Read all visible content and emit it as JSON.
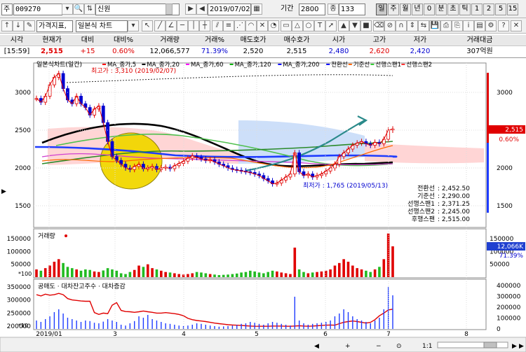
{
  "toolbar": {
    "market_label": "주",
    "code": "009270",
    "name": "신원",
    "date": "2019/07/02",
    "period_label": "기간",
    "period": "2800",
    "count_label": "종",
    "count": "133",
    "intervals": [
      "일",
      "주",
      "월",
      "년",
      "0",
      "분",
      "초",
      "틱",
      "1",
      "2",
      "5",
      "15"
    ],
    "selected_interval": "일",
    "indicator_menu": "가격지표,",
    "chart_type": "일본식 차트"
  },
  "quote": {
    "headers": [
      "시각",
      "현재가",
      "대비",
      "대비%",
      "거래량",
      "거래%",
      "매도호가",
      "매수호가",
      "시가",
      "고가",
      "저가",
      "거래대금"
    ],
    "values": [
      "[15:59]",
      "2,515",
      "+15",
      "0.60%",
      "12,066,577",
      "71.39%",
      "2,520",
      "2,515",
      "2,480",
      "2,620",
      "2,420",
      "307억원"
    ]
  },
  "chart_data": {
    "type": "line",
    "panels": [
      "price",
      "volume",
      "credit"
    ],
    "price_title": "일본식차트(일간)",
    "legend": [
      "MA_종가,5",
      "MA_종가,20",
      "MA_종가,60",
      "MA_종가,120",
      "MA_종가,200",
      "전환선",
      "기준선",
      "선행스팬1",
      "선행스팬2"
    ],
    "legend_colors": [
      "#ff0000",
      "#000000",
      "#ff00ff",
      "#00b000",
      "#0000ff",
      "#0000ff",
      "#ff6600",
      "#33cc33",
      "#ff3333"
    ],
    "price_axis": [
      3000,
      2500,
      2000,
      1500
    ],
    "x_ticks": [
      "2019/01",
      "3",
      "4",
      "5",
      "6",
      "7",
      "8"
    ],
    "max_label": "최고가 : 3,310 (2019/02/07)",
    "min_label": "최저가 : 1,765 (2019/05/13)",
    "current_price": "2,515",
    "current_pct": "0.60%",
    "ichimoku": [
      {
        "label": "전환선",
        "value": ": 2,452.50"
      },
      {
        "label": "기준선",
        "value": ": 2,290.00"
      },
      {
        "label": "선행스팬1",
        "value": ": 2,371.25"
      },
      {
        "label": "선행스팬2",
        "value": ": 2,245.00"
      },
      {
        "label": "후행스팬",
        "value": ": 2,515.00"
      }
    ],
    "closes": [
      2920,
      2870,
      2950,
      3100,
      3200,
      3250,
      3050,
      2900,
      2850,
      2950,
      2850,
      2800,
      2700,
      2780,
      2820,
      2600,
      2350,
      2150,
      2100,
      2050,
      2000,
      1980,
      2020,
      2050,
      1990,
      2000,
      2020,
      1980,
      2000,
      2010,
      1990,
      2030,
      2060,
      2090,
      2130,
      2160,
      2140,
      2120,
      2100,
      2110,
      2080,
      2050,
      2030,
      2000,
      1980,
      1970,
      1960,
      1950,
      1940,
      1920,
      1900,
      1860,
      1830,
      1790,
      1800,
      1840,
      1880,
      1920,
      2200,
      1950,
      1900,
      1920,
      1880,
      1900,
      1920,
      1960,
      2000,
      2050,
      2150,
      2200,
      2250,
      2300,
      2330,
      2350,
      2320,
      2300,
      2340,
      2320,
      2380,
      2500,
      2515
    ],
    "volume_label": "거래량",
    "volume_axis": [
      150000,
      100000,
      50000
    ],
    "volume_unit": "*100",
    "volume_current": "12,066K",
    "volume_pct": "71.39%",
    "volumes": [
      30000,
      25000,
      35000,
      45000,
      60000,
      70000,
      55000,
      40000,
      35000,
      30000,
      25000,
      30000,
      28000,
      22000,
      20000,
      26000,
      35000,
      30000,
      25000,
      15000,
      12000,
      20000,
      28000,
      45000,
      40000,
      50000,
      35000,
      30000,
      25000,
      20000,
      18000,
      15000,
      12000,
      10000,
      12000,
      15000,
      20000,
      18000,
      15000,
      12000,
      10000,
      8000,
      9000,
      10000,
      12000,
      14000,
      18000,
      20000,
      25000,
      22000,
      18000,
      15000,
      20000,
      25000,
      22000,
      18000,
      15000,
      12000,
      115000,
      30000,
      20000,
      15000,
      18000,
      20000,
      22000,
      25000,
      30000,
      45000,
      55000,
      70000,
      60000,
      45000,
      35000,
      30000,
      25000,
      20000,
      30000,
      40000,
      70000,
      170000,
      120000
    ],
    "credit_title": "공매도 · 대차잔고주수 · 대차증감",
    "credit_axis_left": [
      350000,
      300000,
      250000,
      200000
    ],
    "credit_axis_right": [
      400000,
      300000,
      200000,
      100000,
      0
    ],
    "credit_unit": "*10",
    "credit_balance": [
      320000,
      315000,
      322000,
      318000,
      320000,
      325000,
      320000,
      305000,
      300000,
      298000,
      296000,
      295000,
      295000,
      252000,
      245000,
      250000,
      248000,
      280000,
      290000,
      260000,
      256000,
      255000,
      253000,
      255000,
      258000,
      255000,
      253000,
      250000,
      250000,
      252000,
      250000,
      248000,
      245000,
      240000,
      230000,
      225000,
      222000,
      220000,
      218000,
      215000,
      212000,
      210000,
      208000,
      206000,
      205000,
      204000,
      203000,
      202000,
      201000,
      200000,
      200000,
      200000,
      200000,
      201000,
      201000,
      201000,
      200000,
      200000,
      201000,
      202000,
      201000,
      200000,
      201000,
      202000,
      203000,
      204000,
      205000,
      204000,
      210000,
      215000,
      218000,
      220000,
      218000,
      215000,
      212000,
      215000,
      225000,
      240000,
      250000,
      262000,
      265000
    ]
  },
  "scrollbar": {
    "zoom": "1:1"
  }
}
